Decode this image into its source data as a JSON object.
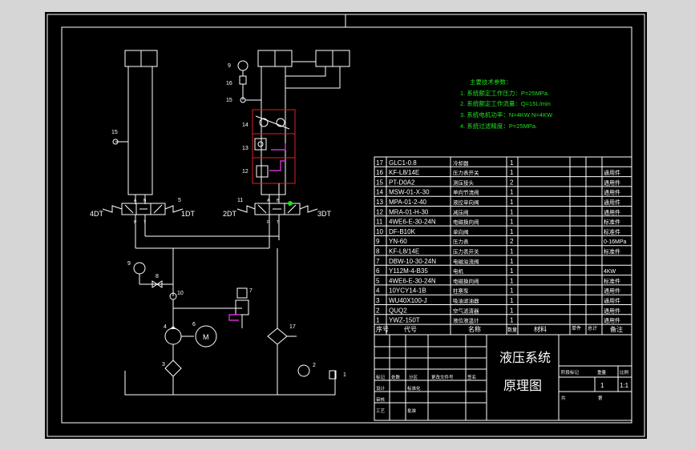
{
  "tech_requirements": {
    "title": "主要技术参数：",
    "items": [
      "1. 系统额定工作压力：P=25MPa.",
      "2. 系统额定工作流量：Q=15L/min",
      "3. 系统电机功率：N=4KW  N=4KW",
      "4. 系统过滤精度：P=25MPa."
    ]
  },
  "component_labels": {
    "gauge_top": "9",
    "valve_16": "16",
    "valve_15_top": "15",
    "valve_15_left": "15",
    "valve_14": "14",
    "valve_13": "13",
    "valve_12": "12",
    "dir_valve_left": "5",
    "dir_valve_right": "11",
    "sol_4dt": "4DT",
    "sol_1dt": "1DT",
    "sol_2dt": "2DT",
    "sol_3dt": "3DT",
    "gauge_left": "9",
    "valve_8": "8",
    "valve_10": "10",
    "relief_7": "7",
    "pump_4": "4",
    "motor_6": "6",
    "filter_3": "3",
    "cooler_17": "17",
    "thermo_2": "2",
    "tank_1": "1",
    "motor_letter": "M",
    "port_p_left": "P",
    "port_t_left": "T",
    "port_p_right": "P",
    "port_t_right": "T",
    "port_a_left": "A",
    "port_b_left": "B",
    "port_a_right": "A",
    "port_b_right": "B"
  },
  "parts_list": {
    "rows": [
      {
        "no": "17",
        "code": "GLC1-0.8",
        "name": "冷却器",
        "qty": "1",
        "note": ""
      },
      {
        "no": "16",
        "code": "KF-L8/14E",
        "name": "压力表开关",
        "qty": "1",
        "note": "通用件"
      },
      {
        "no": "15",
        "code": "PT-D0A2",
        "name": "测压接头",
        "qty": "2",
        "note": "通用件"
      },
      {
        "no": "14",
        "code": "MSW-01-X-30",
        "name": "单向节流阀",
        "qty": "1",
        "note": "通用件"
      },
      {
        "no": "13",
        "code": "MPA-01-2-40",
        "name": "液控单向阀",
        "qty": "1",
        "note": "通用件"
      },
      {
        "no": "12",
        "code": "MRA-01-H-30",
        "name": "减压阀",
        "qty": "1",
        "note": "通用件"
      },
      {
        "no": "11",
        "code": "4WE6-E-30-24N",
        "name": "电磁换向阀",
        "qty": "1",
        "note": "标准件"
      },
      {
        "no": "10",
        "code": "DF-B10K",
        "name": "单向阀",
        "qty": "1",
        "note": "标准件"
      },
      {
        "no": "9",
        "code": "YN-60",
        "name": "压力表",
        "qty": "2",
        "note": "0-16MPa"
      },
      {
        "no": "8",
        "code": "KF-L8/14E",
        "name": "压力表开关",
        "qty": "1",
        "note": "标准件"
      },
      {
        "no": "7",
        "code": "DBW-10-30-24N",
        "name": "电磁溢流阀",
        "qty": "1",
        "note": ""
      },
      {
        "no": "6",
        "code": "Y112M-4-B35",
        "name": "电机",
        "qty": "1",
        "note": "4KW"
      },
      {
        "no": "5",
        "code": "4WE6-E-30-24N",
        "name": "电磁换向阀",
        "qty": "1",
        "note": "标准件"
      },
      {
        "no": "4",
        "code": "10YCY14-1B",
        "name": "柱塞泵",
        "qty": "1",
        "note": "通用件"
      },
      {
        "no": "3",
        "code": "WU40X100-J",
        "name": "吸油滤油器",
        "qty": "1",
        "note": "通用件"
      },
      {
        "no": "2",
        "code": "QUQ2",
        "name": "空气滤清器",
        "qty": "1",
        "note": "通用件"
      },
      {
        "no": "1",
        "code": "YWZ-150T",
        "name": "液位液温计",
        "qty": "1",
        "note": "通用件"
      }
    ],
    "header": {
      "no": "序号",
      "code": "代号",
      "name": "名称",
      "qty": "数量",
      "material": "材料",
      "single": "单件",
      "total": "总计",
      "weight": "重量",
      "note": "备注"
    }
  },
  "title_block": {
    "drawing_title_1": "液压系统",
    "drawing_title_2": "原理图",
    "scale": "1:1",
    "qty": "1",
    "sheet_total_label": "共",
    "sheet_label": "第",
    "labels": [
      "标记",
      "处数",
      "分区",
      "更改文件号",
      "签名",
      "年月日",
      "设计",
      "标准化",
      "阶段标记",
      "重量",
      "比例",
      "审核",
      "工艺",
      "批准"
    ]
  }
}
